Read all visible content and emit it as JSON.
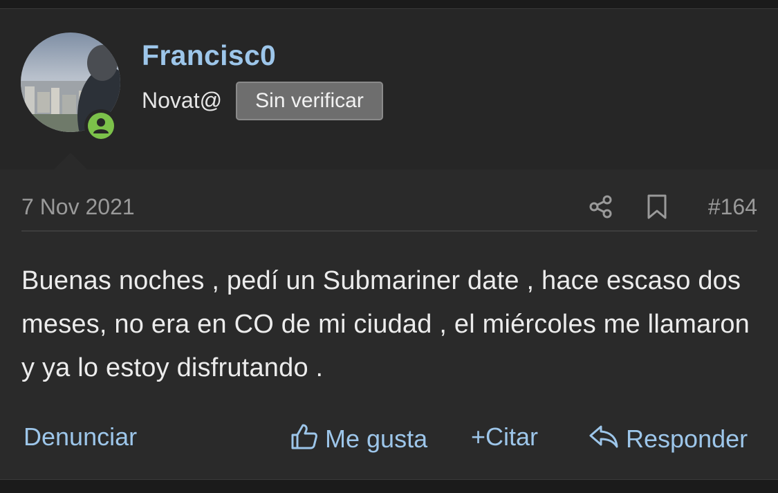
{
  "user": {
    "name": "Francisc0",
    "title": "Novat@",
    "badge": "Sin verificar",
    "avatar": "avatar-photo",
    "status_icon": "user-online-icon",
    "status_color": "#7cc14a"
  },
  "post": {
    "date": "7 Nov 2021",
    "number": "#164",
    "body": "Buenas noches , pedí un Submariner date , hace escaso dos meses, no era en CO de mi ciudad , el miércoles me llamaron y ya lo estoy disfrutando .",
    "icons": [
      "share-icon",
      "bookmark-icon"
    ]
  },
  "actions": {
    "report": "Denunciar",
    "like": "Me gusta",
    "quote": "Citar",
    "reply": "Responder"
  },
  "colors": {
    "accent": "#9dc6ea",
    "background": "#2a2a2a",
    "text": "#ececec"
  }
}
